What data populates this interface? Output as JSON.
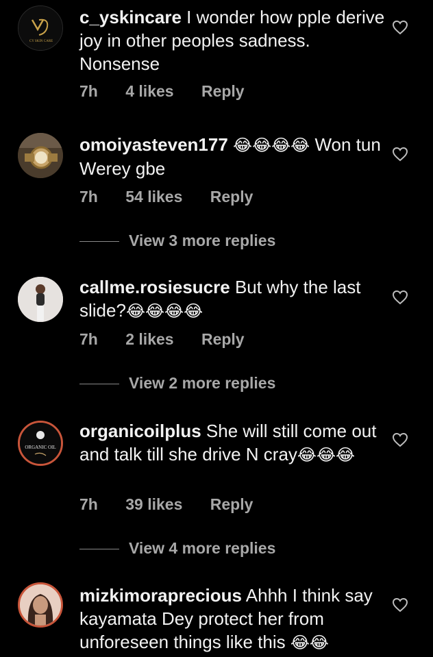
{
  "comments": [
    {
      "username": "c_yskincare",
      "text": "I wonder how pple derive joy in other peoples sadness. Nonsense",
      "emoji": "",
      "time": "7h",
      "likes": "4 likes",
      "reply": "Reply",
      "avatar_text": "CY SKIN CARE"
    },
    {
      "username": "omoiyasteven177",
      "text_before": "",
      "emoji": "😂😂😂😂",
      "text": "Won tun Werey gbe",
      "time": "7h",
      "likes": "54 likes",
      "reply": "Reply"
    },
    {
      "username": "callme.rosiesucre",
      "text": "But why the last slide?",
      "emoji": "😂😂😂😂",
      "time": "7h",
      "likes": "2 likes",
      "reply": "Reply"
    },
    {
      "username": "organicoilplus",
      "text": "She will still come out and talk till she drive N cray",
      "emoji": "😂😂😂",
      "time": "7h",
      "likes": "39 likes",
      "reply": "Reply",
      "avatar_text": "ORGANIC OIL"
    },
    {
      "username": "mizkimoraprecious",
      "text": "Ahhh I think say kayamata Dey protect her from unforeseen things like this",
      "emoji": "😂😂",
      "time": "",
      "likes": "",
      "reply": ""
    }
  ],
  "view_replies": [
    "View 3 more replies",
    "View 2 more replies",
    "View 4 more replies"
  ],
  "colors": {
    "background": "#000000",
    "text": "#f2f2f2",
    "meta": "#a8a8a8",
    "heart": "#bdbdbd"
  },
  "icons": {
    "like": "heart-outline-icon"
  }
}
